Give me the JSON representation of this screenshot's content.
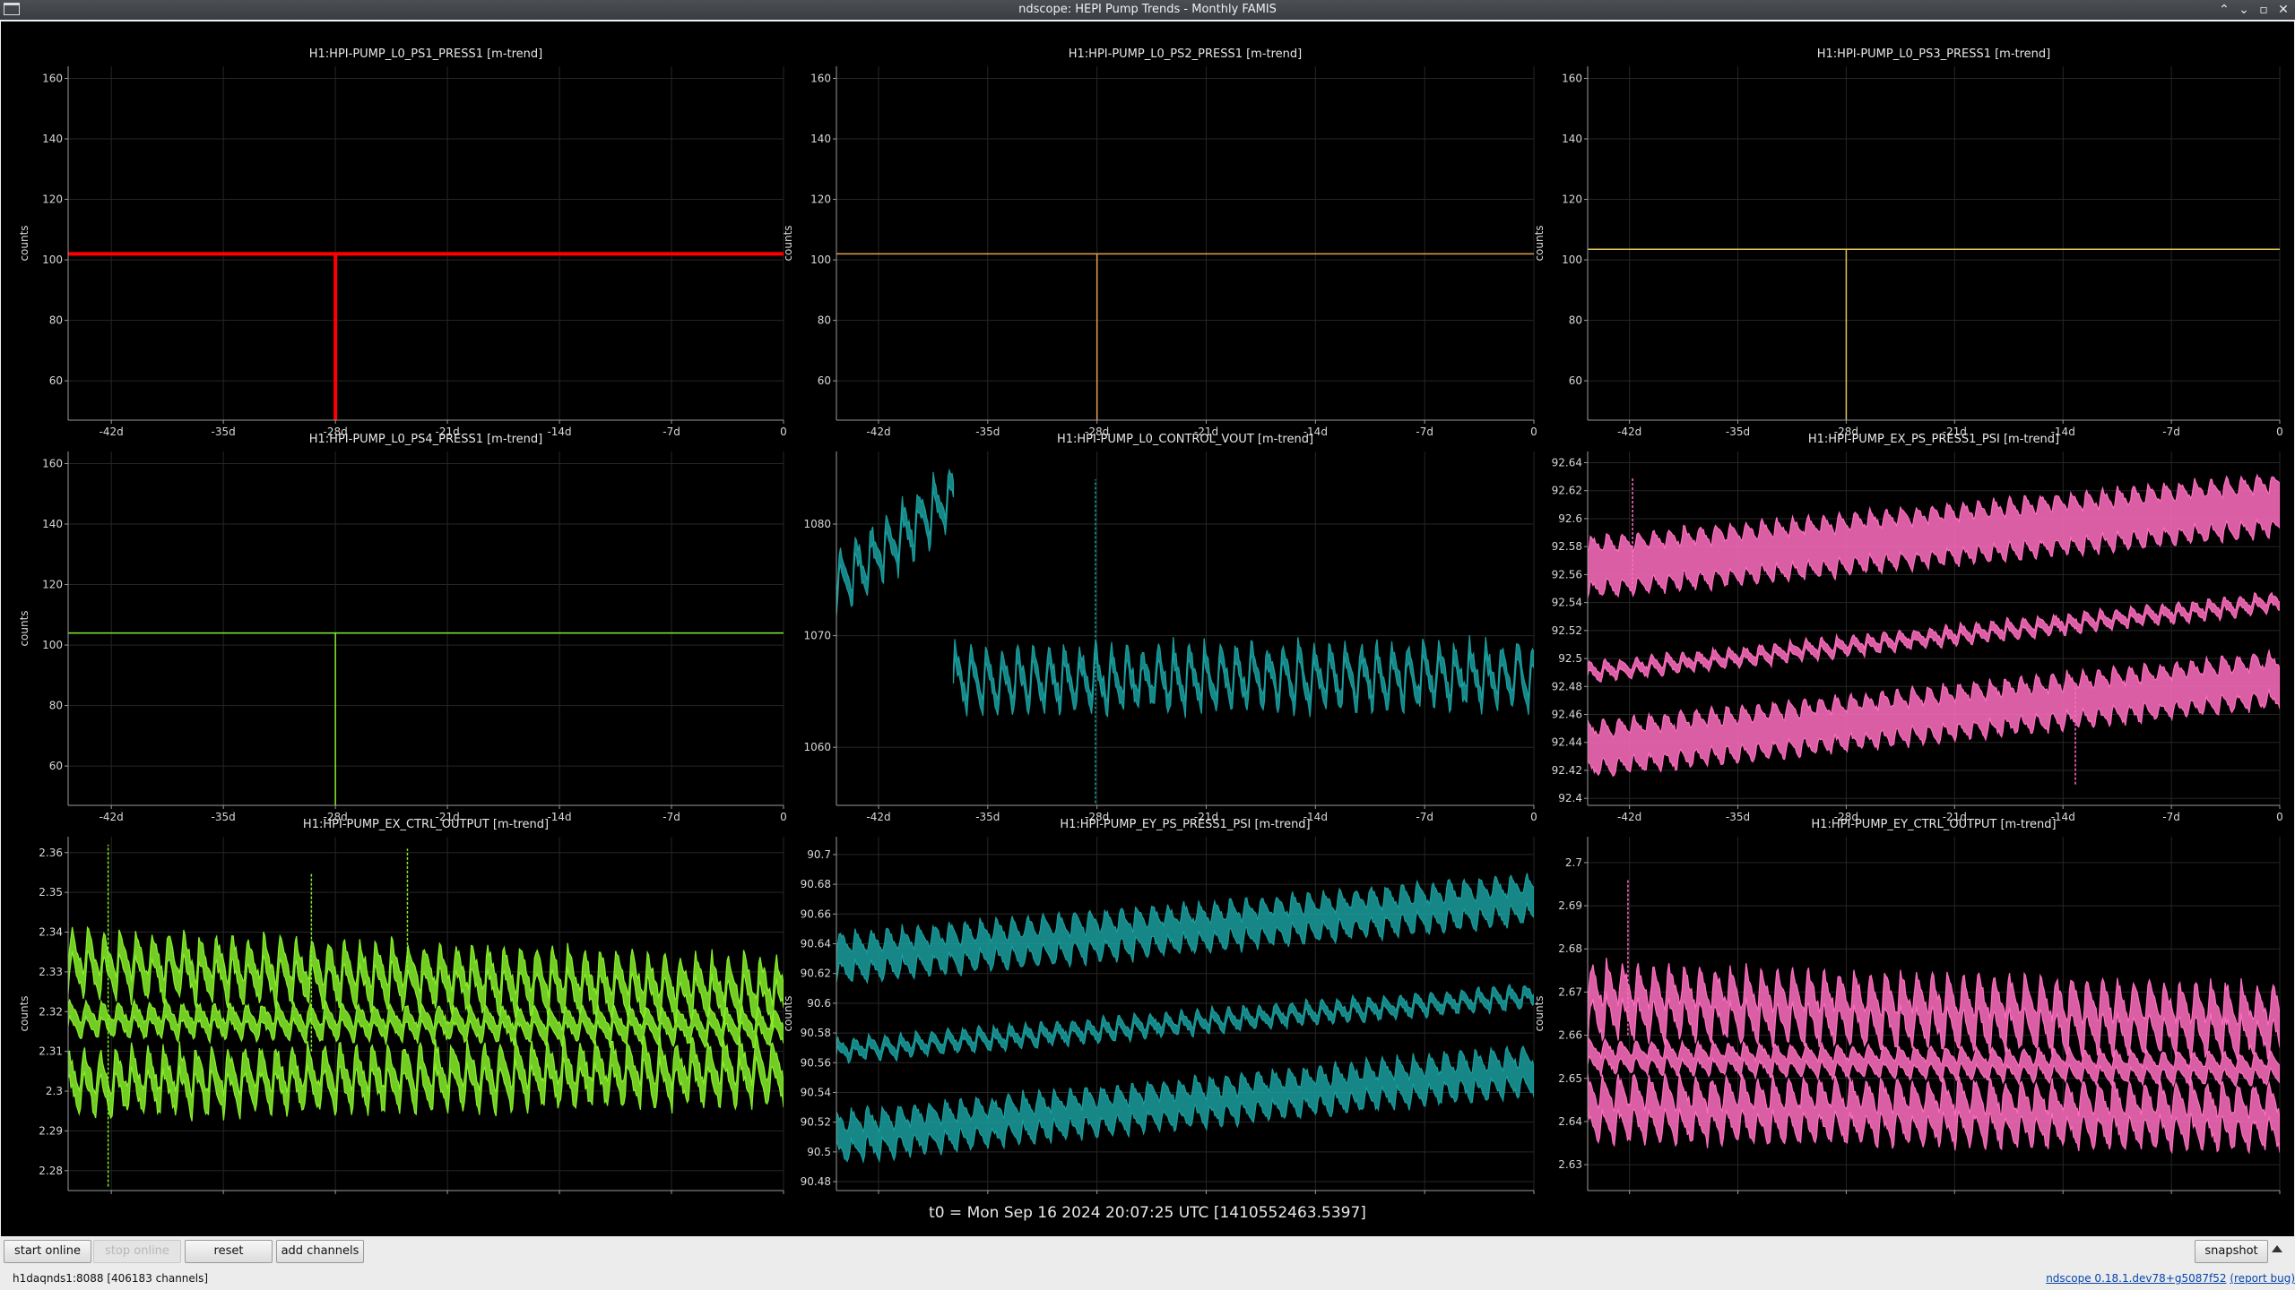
{
  "window": {
    "title": "ndscope: HEPI Pump Trends - Monthly FAMIS"
  },
  "time_axis_ticks": [
    "-42d",
    "-35d",
    "-28d",
    "-21d",
    "-14d",
    "-7d",
    "0"
  ],
  "colors": {
    "red": "#ff0000",
    "orange": "#e8a24a",
    "yellow": "#e0c458",
    "lime": "#86f02a",
    "teal": "#1a9e9e",
    "pink": "#ff6ec0"
  },
  "chart_data": [
    {
      "type": "line",
      "title": "H1:HPI-PUMP_L0_PS1_PRESS1 [m-trend]",
      "ylabel": "counts",
      "color": "red",
      "style": "flat_spike",
      "ylim": [
        47,
        164
      ],
      "yticks": [
        "60",
        "80",
        "100",
        "120",
        "140",
        "160"
      ],
      "ytick_values": [
        60,
        80,
        100,
        120,
        140,
        160
      ],
      "level": 102,
      "spike_x_days": -28,
      "spike_min": 47,
      "line_width": 4
    },
    {
      "type": "line",
      "title": "H1:HPI-PUMP_L0_PS2_PRESS1 [m-trend]",
      "ylabel": "counts",
      "color": "orange",
      "style": "flat_spike",
      "ylim": [
        47,
        164
      ],
      "yticks": [
        "60",
        "80",
        "100",
        "120",
        "140",
        "160"
      ],
      "ytick_values": [
        60,
        80,
        100,
        120,
        140,
        160
      ],
      "level": 102,
      "spike_x_days": -28,
      "spike_min": 47,
      "line_width": 1.5
    },
    {
      "type": "line",
      "title": "H1:HPI-PUMP_L0_PS3_PRESS1 [m-trend]",
      "ylabel": "counts",
      "color": "yellow",
      "style": "flat_spike",
      "ylim": [
        47,
        164
      ],
      "yticks": [
        "60",
        "80",
        "100",
        "120",
        "140",
        "160"
      ],
      "ytick_values": [
        60,
        80,
        100,
        120,
        140,
        160
      ],
      "level": 103.5,
      "spike_x_days": -28,
      "spike_min": 47,
      "line_width": 1.5
    },
    {
      "type": "line",
      "title": "H1:HPI-PUMP_L0_PS4_PRESS1 [m-trend]",
      "ylabel": "counts",
      "color": "lime",
      "style": "flat_spike",
      "ylim": [
        47,
        164
      ],
      "yticks": [
        "60",
        "80",
        "100",
        "120",
        "140",
        "160"
      ],
      "ytick_values": [
        60,
        80,
        100,
        120,
        140,
        160
      ],
      "level": 104,
      "spike_x_days": -28,
      "spike_min": 47,
      "line_width": 1.5
    },
    {
      "type": "line",
      "title": "H1:HPI-PUMP_L0_CONTROL_VOUT [m-trend]",
      "ylabel": "",
      "color": "teal",
      "style": "noisy_band",
      "ylim": [
        1054.8,
        1086.5
      ],
      "yticks": [
        "1060",
        "1070",
        "1080"
      ],
      "ytick_values": [
        1060,
        1070,
        1080
      ],
      "segments": [
        {
          "x0": -44.7,
          "x1": -37.2,
          "mean0": 1074.5,
          "mean1": 1082.5
        },
        {
          "x0": -37.2,
          "x1": 0,
          "mean0": 1066,
          "mean1": 1066.5
        }
      ],
      "osc_amp": 5,
      "osc_period_days": 1,
      "band_halfwidth": 0.7,
      "spikes": [
        {
          "x": -28.1,
          "y0": 1055,
          "y1": 1084
        }
      ]
    },
    {
      "type": "line",
      "title": "H1:HPI-PUMP_EX_PS_PRESS1_PSI [m-trend]",
      "ylabel": "",
      "color": "pink",
      "style": "three_bands",
      "ylim": [
        92.395,
        92.648
      ],
      "yticks": [
        "92.4",
        "92.42",
        "92.44",
        "92.46",
        "92.48",
        "92.5",
        "92.52",
        "92.54",
        "92.56",
        "92.58",
        "92.6",
        "92.62",
        "92.64"
      ],
      "ytick_values": [
        92.4,
        92.42,
        92.44,
        92.46,
        92.48,
        92.5,
        92.52,
        92.54,
        92.56,
        92.58,
        92.6,
        92.62,
        92.64
      ],
      "bands": [
        {
          "mean0": 92.565,
          "mean1": 92.61,
          "halfwidth": 0.016,
          "amp": 0.014
        },
        {
          "mean0": 92.49,
          "mean1": 92.54,
          "halfwidth": 0.003,
          "amp": 0.01
        },
        {
          "mean0": 92.435,
          "mean1": 92.485,
          "halfwidth": 0.014,
          "amp": 0.014
        }
      ],
      "osc_period_days": 1,
      "spikes": [
        {
          "x": -41.8,
          "y0": 92.55,
          "y1": 92.63
        },
        {
          "x": -13.2,
          "y0": 92.41,
          "y1": 92.48
        }
      ]
    },
    {
      "type": "line",
      "title": "H1:HPI-PUMP_EX_CTRL_OUTPUT [m-trend]",
      "ylabel": "counts",
      "color": "lime",
      "style": "three_bands",
      "ylim": [
        2.275,
        2.364
      ],
      "yticks": [
        "2.28",
        "2.29",
        "2.3",
        "2.31",
        "2.32",
        "2.33",
        "2.34",
        "2.35",
        "2.36"
      ],
      "ytick_values": [
        2.28,
        2.29,
        2.3,
        2.31,
        2.32,
        2.33,
        2.34,
        2.35,
        2.36
      ],
      "bands": [
        {
          "mean0": 2.332,
          "mean1": 2.325,
          "halfwidth": 0.003,
          "amp": 0.012
        },
        {
          "mean0": 2.318,
          "mean1": 2.316,
          "halfwidth": 0.002,
          "amp": 0.006
        },
        {
          "mean0": 2.302,
          "mean1": 2.305,
          "halfwidth": 0.003,
          "amp": 0.012
        }
      ],
      "osc_period_days": 1,
      "spikes": [
        {
          "x": -42.2,
          "y0": 2.276,
          "y1": 2.362
        },
        {
          "x": -29.5,
          "y0": 2.31,
          "y1": 2.355
        },
        {
          "x": -23.5,
          "y0": 2.33,
          "y1": 2.361
        }
      ]
    },
    {
      "type": "line",
      "title": "H1:HPI-PUMP_EY_PS_PRESS1_PSI [m-trend]",
      "ylabel": "counts",
      "color": "teal",
      "style": "three_bands",
      "ylim": [
        90.474,
        90.712
      ],
      "yticks": [
        "90.48",
        "90.5",
        "90.52",
        "90.54",
        "90.56",
        "90.58",
        "90.6",
        "90.62",
        "90.64",
        "90.66",
        "90.68",
        "90.7"
      ],
      "ytick_values": [
        90.48,
        90.5,
        90.52,
        90.54,
        90.56,
        90.58,
        90.6,
        90.62,
        90.64,
        90.66,
        90.68,
        90.7
      ],
      "bands": [
        {
          "mean0": 90.63,
          "mean1": 90.67,
          "halfwidth": 0.01,
          "amp": 0.016
        },
        {
          "mean0": 90.568,
          "mean1": 90.605,
          "halfwidth": 0.003,
          "amp": 0.012
        },
        {
          "mean0": 90.51,
          "mean1": 90.555,
          "halfwidth": 0.01,
          "amp": 0.016
        }
      ],
      "osc_period_days": 1,
      "spikes": []
    },
    {
      "type": "line",
      "title": "H1:HPI-PUMP_EY_CTRL_OUTPUT [m-trend]",
      "ylabel": "counts",
      "color": "pink",
      "style": "three_bands",
      "ylim": [
        2.624,
        2.706
      ],
      "yticks": [
        "2.63",
        "2.64",
        "2.65",
        "2.66",
        "2.67",
        "2.68",
        "2.69",
        "2.7"
      ],
      "ytick_values": [
        2.63,
        2.64,
        2.65,
        2.66,
        2.67,
        2.68,
        2.69,
        2.7
      ],
      "bands": [
        {
          "mean0": 2.668,
          "mean1": 2.663,
          "halfwidth": 0.004,
          "amp": 0.01
        },
        {
          "mean0": 2.655,
          "mean1": 2.652,
          "halfwidth": 0.002,
          "amp": 0.004
        },
        {
          "mean0": 2.643,
          "mean1": 2.641,
          "halfwidth": 0.004,
          "amp": 0.008
        }
      ],
      "osc_period_days": 1,
      "spikes": [
        {
          "x": -42.1,
          "y0": 2.66,
          "y1": 2.696
        }
      ]
    }
  ],
  "t0_label": "t0 = Mon Sep 16 2024 20:07:25 UTC [1410552463.5397]",
  "toolbar": {
    "start_online": "start online",
    "stop_online": "stop online",
    "reset": "reset",
    "add_channels": "add channels",
    "snapshot": "snapshot"
  },
  "status": {
    "server": "h1daqnds1:8088  [406183 channels]",
    "version": "ndscope 0.18.1.dev78+g5087f52",
    "report_bug": "(report bug)"
  }
}
